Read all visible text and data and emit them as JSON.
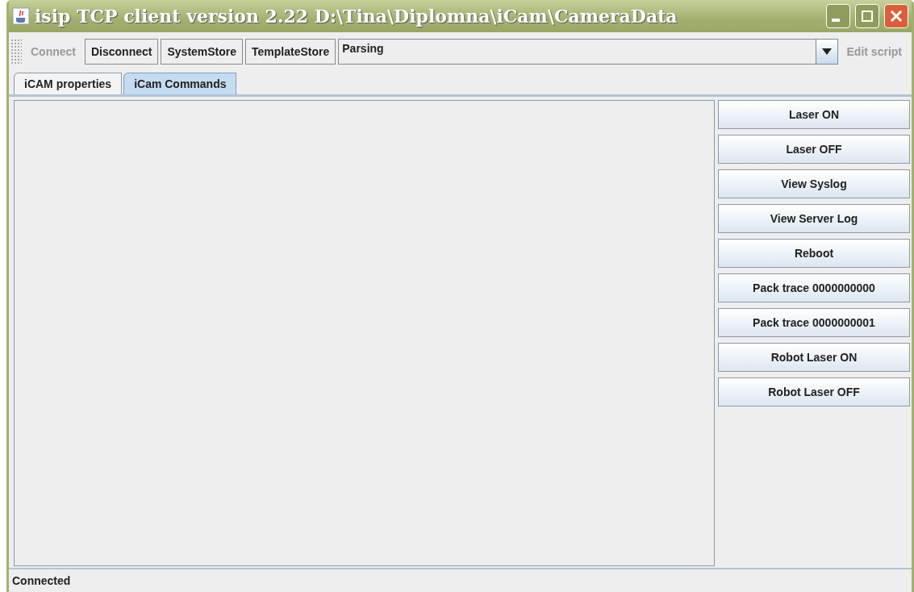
{
  "window": {
    "title": "isip TCP client version 2.22 D:\\Tina\\Diplomna\\iCam\\CameraData"
  },
  "toolbar": {
    "buttons": [
      {
        "label": "Connect",
        "disabled": true
      },
      {
        "label": "Disconnect",
        "disabled": false
      },
      {
        "label": "SystemStore",
        "disabled": false
      },
      {
        "label": "TemplateStore",
        "disabled": false
      }
    ],
    "script_select": {
      "value": "Parsing"
    },
    "edit_button": {
      "label": "Edit script",
      "disabled": true
    }
  },
  "tabs": [
    {
      "label": "iCAM properties",
      "selected": false
    },
    {
      "label": "iCam Commands",
      "selected": true
    }
  ],
  "commands": [
    {
      "label": "Laser ON"
    },
    {
      "label": "Laser OFF"
    },
    {
      "label": "View Syslog"
    },
    {
      "label": "View Server Log"
    },
    {
      "label": "Reboot"
    },
    {
      "label": "Pack trace 0000000000"
    },
    {
      "label": "Pack trace 0000000001"
    },
    {
      "label": "Robot Laser ON"
    },
    {
      "label": "Robot Laser OFF"
    }
  ],
  "status_bar": {
    "text": "Connected"
  }
}
